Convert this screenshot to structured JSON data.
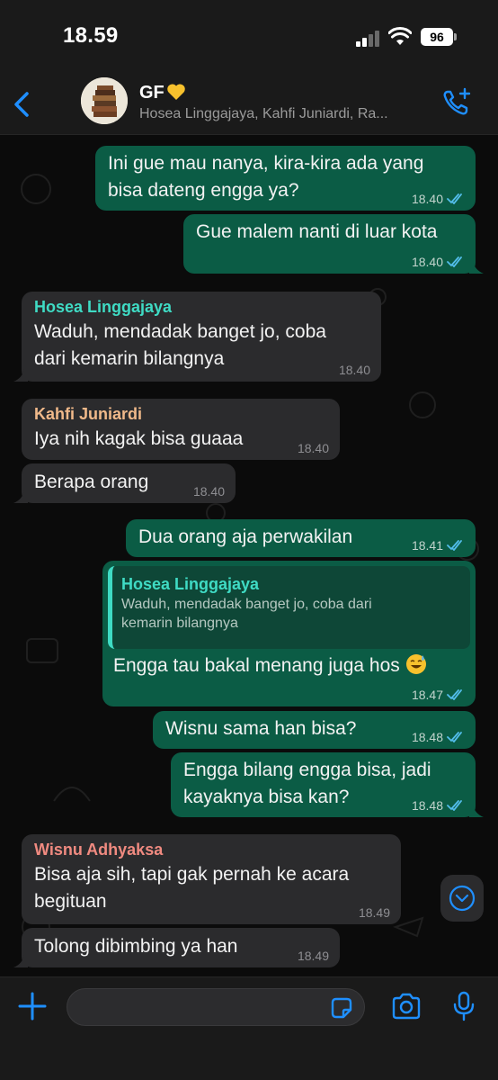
{
  "status": {
    "time": "18.59",
    "battery": "96"
  },
  "header": {
    "group_name": "GF",
    "members": "Hosea Linggajaya, Kahfi Juniardi, Ra..."
  },
  "messages": [
    {
      "text": "Ini gue mau nanya, kira-kira ada yang bisa dateng engga ya?",
      "time": "18.40"
    },
    {
      "text": "Gue malem nanti di luar kota",
      "time": "18.40"
    },
    {
      "sender": "Hosea Linggajaya",
      "text": "Waduh, mendadak banget jo, coba dari kemarin bilangnya",
      "time": "18.40"
    },
    {
      "sender": "Kahfi Juniardi",
      "text": "Iya nih kagak bisa guaaa",
      "time": "18.40"
    },
    {
      "text": "Berapa orang",
      "time": "18.40"
    },
    {
      "text": "Dua orang aja perwakilan",
      "time": "18.41"
    },
    {
      "quote_sender": "Hosea Linggajaya",
      "quote_text": "Waduh, mendadak banget jo, coba dari kemarin bilangnya",
      "text": "Engga tau bakal menang juga hos",
      "time": "18.47"
    },
    {
      "text": "Wisnu sama han bisa?",
      "time": "18.48"
    },
    {
      "text": "Engga bilang engga bisa, jadi kayaknya bisa kan?",
      "time": "18.48"
    },
    {
      "sender": "Wisnu Adhyaksa",
      "text": "Bisa aja sih, tapi gak pernah ke acara begituan",
      "time": "18.49"
    },
    {
      "text": "Tolong dibimbing ya han",
      "time": "18.49"
    }
  ],
  "colors": {
    "outgoing_bubble": "#0b5c45",
    "incoming_bubble": "#2b2b2d",
    "accent": "#1f8fff",
    "sender_hosea": "#3fdbc4",
    "sender_kahfi": "#f0b98a",
    "sender_wisnu": "#f08a80",
    "read_ticks": "#53bdeb"
  },
  "icons": [
    "back-chevron-icon",
    "yellow-heart-icon",
    "add-call-icon",
    "double-tick-icon",
    "sweat-smile-emoji",
    "chevron-down-icon",
    "plus-icon",
    "sticker-icon",
    "camera-icon",
    "microphone-icon"
  ]
}
